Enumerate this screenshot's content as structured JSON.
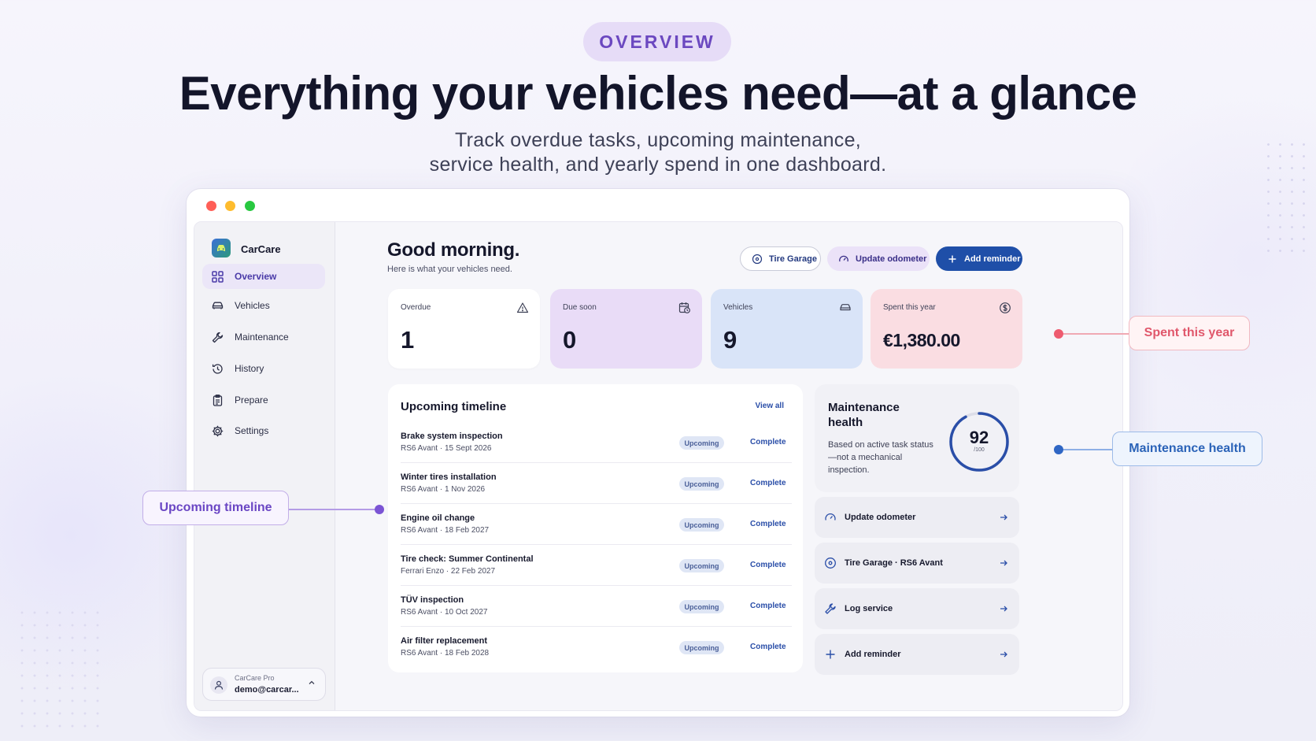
{
  "hero": {
    "pill": "OVERVIEW",
    "headline": "Everything your vehicles need—at a glance",
    "subline1": "Track overdue tasks, upcoming maintenance,",
    "subline2": "service health, and yearly spend in one dashboard."
  },
  "sidebar": {
    "brand": "CarCare",
    "items": [
      {
        "label": "Overview",
        "icon": "grid-icon"
      },
      {
        "label": "Vehicles",
        "icon": "car-icon"
      },
      {
        "label": "Maintenance",
        "icon": "wrench-icon"
      },
      {
        "label": "History",
        "icon": "history-icon"
      },
      {
        "label": "Prepare",
        "icon": "clipboard-icon"
      },
      {
        "label": "Settings",
        "icon": "gear-icon"
      }
    ],
    "user": {
      "plan": "CarCare Pro",
      "email": "demo@carcar..."
    }
  },
  "header": {
    "greeting": "Good morning.",
    "subtitle": "Here is what your vehicles need.",
    "buttons": {
      "tire": "Tire Garage",
      "odometer": "Update odometer",
      "add": "Add reminder"
    }
  },
  "stats": [
    {
      "label": "Overdue",
      "value": "1",
      "icon": "warning-icon"
    },
    {
      "label": "Due soon",
      "value": "0",
      "icon": "calendar-clock-icon"
    },
    {
      "label": "Vehicles",
      "value": "9",
      "icon": "car-icon"
    },
    {
      "label": "Spent this year",
      "value": "€1,380.00",
      "icon": "dollar-circle-icon"
    }
  ],
  "timeline": {
    "title": "Upcoming timeline",
    "view_all": "View all",
    "rows": [
      {
        "name": "Brake system inspection",
        "meta": "RS6 Avant · 15 Sept 2026",
        "badge": "Upcoming",
        "action": "Complete"
      },
      {
        "name": "Winter tires installation",
        "meta": "RS6 Avant · 1 Nov 2026",
        "badge": "Upcoming",
        "action": "Complete"
      },
      {
        "name": "Engine oil change",
        "meta": "RS6 Avant · 18 Feb 2027",
        "badge": "Upcoming",
        "action": "Complete"
      },
      {
        "name": "Tire check: Summer Continental",
        "meta": "Ferrari Enzo · 22 Feb 2027",
        "badge": "Upcoming",
        "action": "Complete"
      },
      {
        "name": "TÜV inspection",
        "meta": "RS6 Avant · 10 Oct 2027",
        "badge": "Upcoming",
        "action": "Complete"
      },
      {
        "name": "Air filter replacement",
        "meta": "RS6 Avant · 18 Feb 2028",
        "badge": "Upcoming",
        "action": "Complete"
      }
    ]
  },
  "health": {
    "title": "Maintenance health",
    "description": "Based on active task status—not a mechanical inspection.",
    "score": "92",
    "score_max": "/100",
    "score_fraction": 0.92
  },
  "actions": [
    {
      "label": "Update odometer",
      "icon": "gauge-icon"
    },
    {
      "label": "Tire Garage · RS6 Avant",
      "icon": "tire-icon"
    },
    {
      "label": "Log service",
      "icon": "wrench-icon"
    },
    {
      "label": "Add reminder",
      "icon": "plus-icon"
    }
  ],
  "callouts": {
    "spent": "Spent this year",
    "health": "Maintenance health",
    "timeline": "Upcoming timeline"
  },
  "colors": {
    "accent": "#1f4fa8",
    "purple": "#6b48c0",
    "pink": "#e0576b",
    "window_red": "#ff5f57",
    "window_yellow": "#febc2e",
    "window_green": "#28c840"
  }
}
